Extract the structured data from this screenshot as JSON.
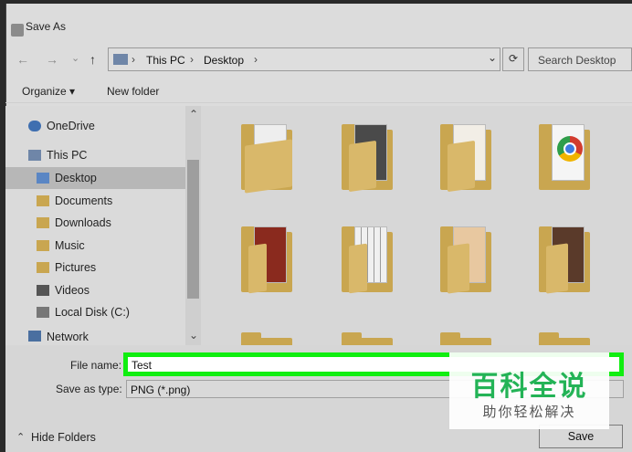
{
  "window": {
    "title": "Save As"
  },
  "address": {
    "segments": [
      "This PC",
      "Desktop"
    ],
    "search_placeholder": "Search Desktop"
  },
  "commands": {
    "organize": "Organize",
    "organize_caret": "▾",
    "new_folder": "New folder"
  },
  "tree": {
    "onedrive": "OneDrive",
    "this_pc": "This PC",
    "desktop": "Desktop",
    "documents": "Documents",
    "downloads": "Downloads",
    "music": "Music",
    "pictures": "Pictures",
    "videos": "Videos",
    "local_disk": "Local Disk (C:)",
    "network": "Network"
  },
  "form": {
    "file_name_label": "File name:",
    "file_name_value": "Test",
    "save_type_label": "Save as type:",
    "save_type_value": "PNG (*.png)"
  },
  "footer": {
    "hide_folders": "Hide Folders",
    "save": "Save"
  },
  "watermark": {
    "line1": "百科全说",
    "line2": "助你轻松解决"
  },
  "colors": {
    "highlight": "#10ee10",
    "folder": "#c9a650",
    "watermark_green": "#23b356"
  },
  "glyphs": {
    "back": "←",
    "forward": "→",
    "down": "⌄",
    "up": "↑",
    "chev": "›",
    "refresh": "⟳",
    "scroll_up": "⌃",
    "scroll_down": "⌄",
    "expand": "⌃"
  }
}
